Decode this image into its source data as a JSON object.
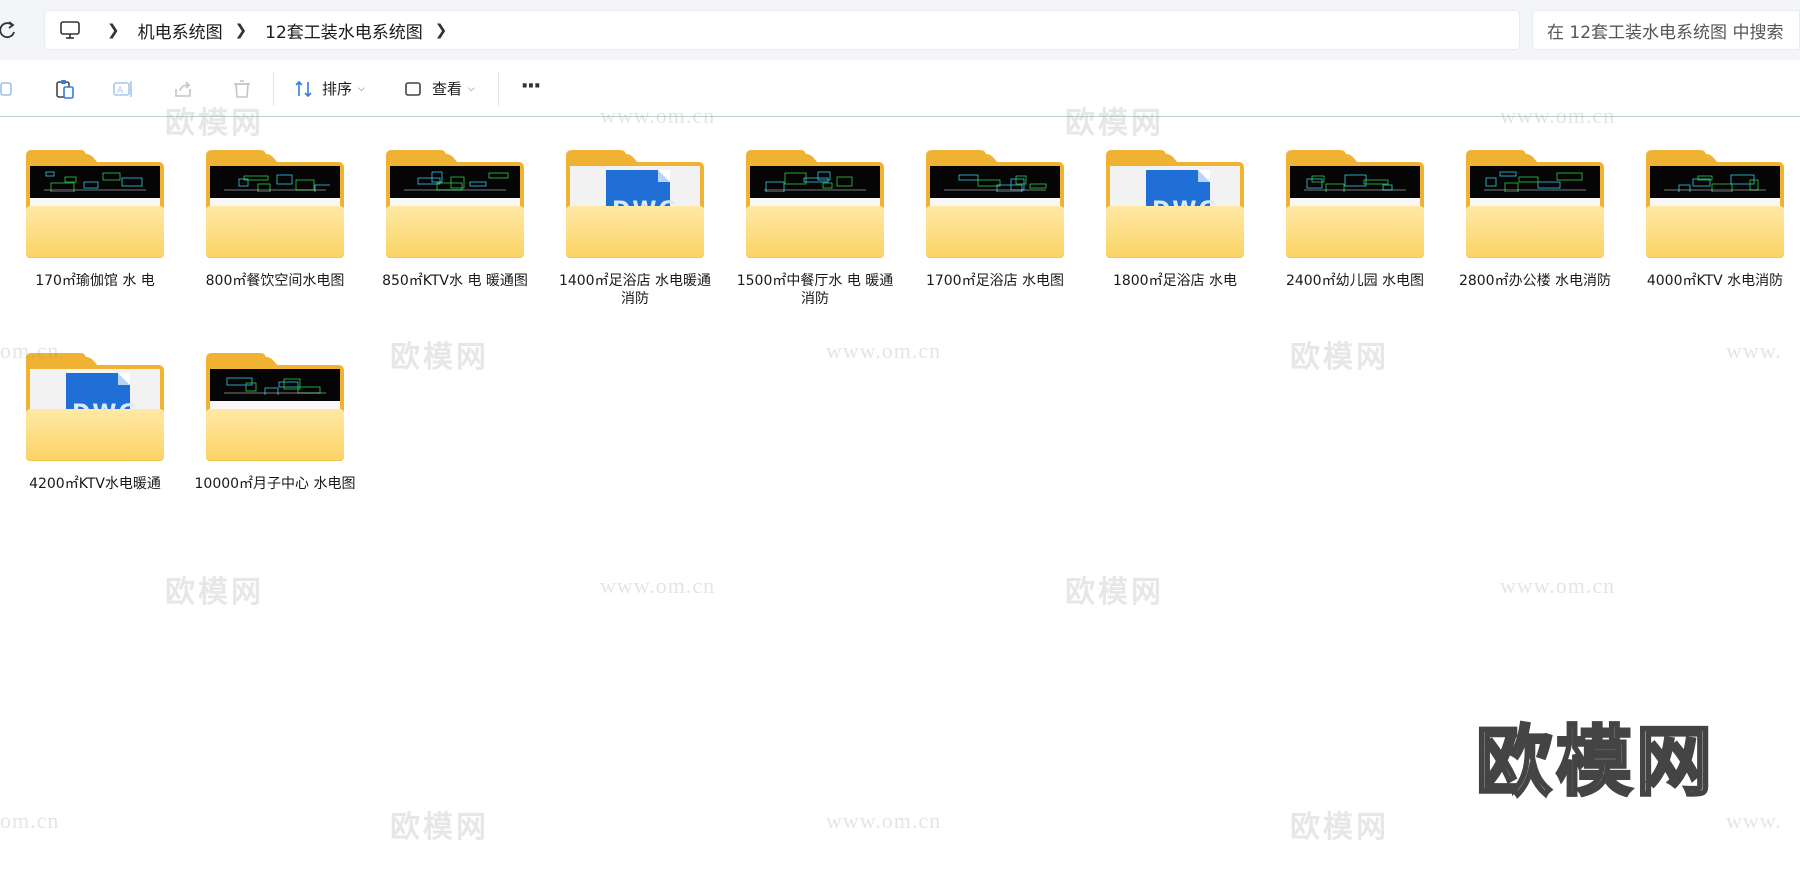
{
  "addressbar": {
    "root_icon": "computer-icon",
    "crumbs": [
      "机电系统图",
      "12套工装水电系统图"
    ],
    "search_placeholder": "在 12套工装水电系统图 中搜索"
  },
  "toolbar": {
    "sort_label": "排序",
    "view_label": "查看",
    "more_label": "···"
  },
  "folders": [
    {
      "name": "170㎡瑜伽馆 水 电",
      "preview": "cad"
    },
    {
      "name": "800㎡餐饮空间水电图",
      "preview": "cad"
    },
    {
      "name": "850㎡KTV水 电 暖通图",
      "preview": "cad"
    },
    {
      "name": "1400㎡足浴店 水电暖通消防",
      "preview": "dwg"
    },
    {
      "name": "1500㎡中餐厅水 电 暖通 消防",
      "preview": "cad"
    },
    {
      "name": "1700㎡足浴店 水电图",
      "preview": "cad"
    },
    {
      "name": "1800㎡足浴店 水电",
      "preview": "dwg"
    },
    {
      "name": "2400㎡幼儿园 水电图",
      "preview": "cad"
    },
    {
      "name": "2800㎡办公楼 水电消防",
      "preview": "cad"
    },
    {
      "name": "4000㎡KTV 水电消防",
      "preview": "cad"
    },
    {
      "name": "4200㎡KTV水电暖通",
      "preview": "dwg"
    },
    {
      "name": "10000㎡月子中心 水电图",
      "preview": "cad"
    }
  ],
  "watermarks": {
    "brand": "欧模网",
    "site": "www.om.cn",
    "site_partial": "om.cn",
    "site_partial_right": "www."
  },
  "colors": {
    "folder_back": "#f0b232",
    "folder_front": "#fbd364",
    "dwg_blue": "#1f6fd6",
    "divider": "#b8d3ce"
  }
}
